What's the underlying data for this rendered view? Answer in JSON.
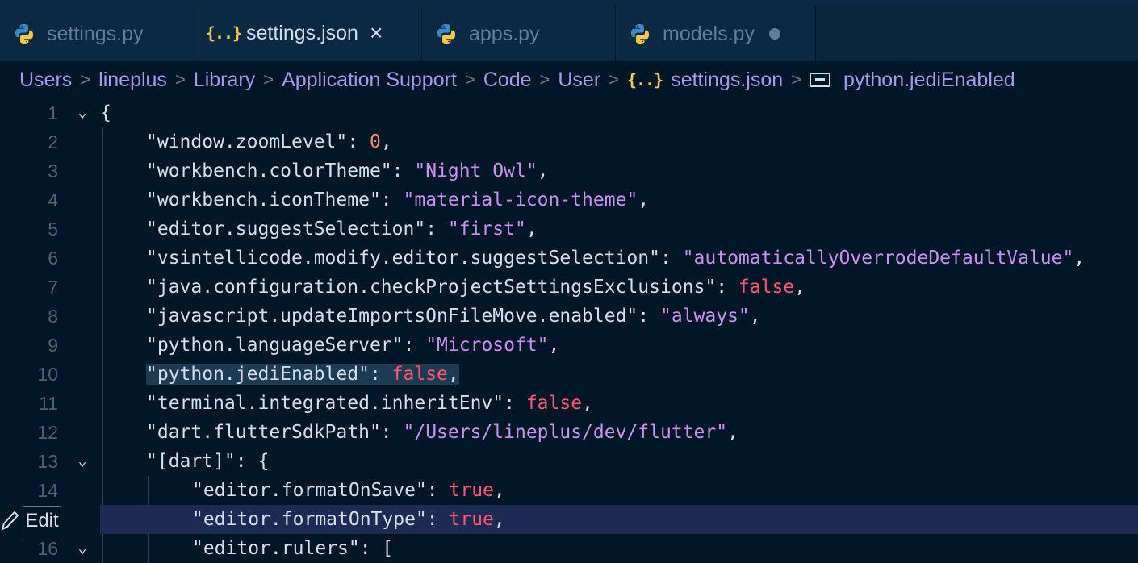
{
  "tabs": [
    {
      "label": "settings.py",
      "icon": "python-icon"
    },
    {
      "label": "settings.json",
      "icon": "json-icon",
      "close": "×"
    },
    {
      "label": "apps.py",
      "icon": "python-icon"
    },
    {
      "label": "models.py",
      "icon": "python-icon",
      "modified": true
    }
  ],
  "json_icon_glyph": "{..}",
  "breadcrumb": [
    "Users",
    "lineplus",
    "Library",
    "Application Support",
    "Code",
    "User",
    "settings.json",
    "python.jediEnabled"
  ],
  "breadcrumb_sep": ">",
  "lines": [
    {
      "n": "1",
      "key": "",
      "sep": "{",
      "val": ""
    },
    {
      "n": "2",
      "key": "\"window.zoomLevel\"",
      "sep": ": ",
      "val": "0",
      "tail": ","
    },
    {
      "n": "3",
      "key": "\"workbench.colorTheme\"",
      "sep": ": ",
      "val": "\"Night Owl\"",
      "tail": ","
    },
    {
      "n": "4",
      "key": "\"workbench.iconTheme\"",
      "sep": ": ",
      "val": "\"material-icon-theme\"",
      "tail": ","
    },
    {
      "n": "5",
      "key": "\"editor.suggestSelection\"",
      "sep": ": ",
      "val": "\"first\"",
      "tail": ","
    },
    {
      "n": "6",
      "key": "\"vsintellicode.modify.editor.suggestSelection\"",
      "sep": ": ",
      "val": "\"automaticallyOverrodeDefaultValue\"",
      "tail": ","
    },
    {
      "n": "7",
      "key": "\"java.configuration.checkProjectSettingsExclusions\"",
      "sep": ": ",
      "val": "false",
      "tail": ","
    },
    {
      "n": "8",
      "key": "\"javascript.updateImportsOnFileMove.enabled\"",
      "sep": ": ",
      "val": "\"always\"",
      "tail": ","
    },
    {
      "n": "9",
      "key": "\"python.languageServer\"",
      "sep": ": ",
      "val": "\"Microsoft\"",
      "tail": ","
    },
    {
      "n": "10",
      "key": "\"python.jediEnabled\"",
      "sep": ": ",
      "val": "false",
      "tail": ","
    },
    {
      "n": "11",
      "key": "\"terminal.integrated.inheritEnv\"",
      "sep": ": ",
      "val": "false",
      "tail": ","
    },
    {
      "n": "12",
      "key": "\"dart.flutterSdkPath\"",
      "sep": ": ",
      "val": "\"/Users/lineplus/dev/flutter\"",
      "tail": ","
    },
    {
      "n": "13",
      "key": "\"[dart]\"",
      "sep": ": ",
      "val": "{",
      "tail": ""
    },
    {
      "n": "14",
      "key": "\"editor.formatOnSave\"",
      "sep": ": ",
      "val": "true",
      "tail": ","
    },
    {
      "n": "15",
      "key": "\"editor.formatOnType\"",
      "sep": ": ",
      "val": "true",
      "tail": ","
    },
    {
      "n": "16",
      "key": "\"editor.rulers\"",
      "sep": ": ",
      "val": "[",
      "tail": ""
    }
  ],
  "hover": {
    "edit_label": "Edit"
  },
  "colors": {
    "background": "#011627",
    "key": "#d6deeb",
    "string": "#c792ea",
    "number": "#f78c6c",
    "boolean": "#ff5874",
    "current_line": "#1d2a52"
  }
}
